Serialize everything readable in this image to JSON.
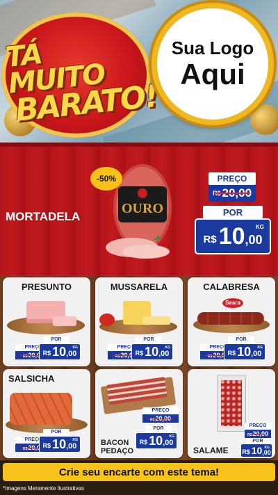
{
  "header": {
    "slogan_line1": "TÁ MUITO",
    "slogan_line2": "BARATO!",
    "logo_line1": "Sua Logo",
    "logo_line2": "Aqui"
  },
  "featured": {
    "name": "MORTADELA",
    "discount": "-50%",
    "brand_label": "OURO",
    "preco_label": "PREÇO",
    "old_currency": "R$",
    "old_price": "20,00",
    "por_label": "POR",
    "currency": "R$",
    "price_int": "10",
    "price_dec": ",00",
    "unit": "KG"
  },
  "cards": [
    {
      "name": "PRESUNTO",
      "preco_label": "PREÇO",
      "old_currency": "R$",
      "old_price": "20,00",
      "por_label": "POR",
      "currency": "R$",
      "price_int": "10",
      "price_dec": ",00",
      "unit": "KG"
    },
    {
      "name": "MUSSARELA",
      "preco_label": "PREÇO",
      "old_currency": "R$",
      "old_price": "20,00",
      "por_label": "POR",
      "currency": "R$",
      "price_int": "10",
      "price_dec": ",00",
      "unit": "KG"
    },
    {
      "name": "CALABRESA",
      "brand": "Seara",
      "preco_label": "PREÇO",
      "old_currency": "R$",
      "old_price": "20,00",
      "por_label": "POR",
      "currency": "R$",
      "price_int": "10",
      "price_dec": ",00",
      "unit": "KG"
    },
    {
      "name": "SALSICHA",
      "preco_label": "PREÇO",
      "old_currency": "R$",
      "old_price": "20,00",
      "por_label": "POR",
      "currency": "R$",
      "price_int": "10",
      "price_dec": ",00",
      "unit": "KG"
    },
    {
      "name_line1": "BACON",
      "name_line2": "PEDAÇO",
      "preco_label": "PREÇO",
      "old_currency": "R$",
      "old_price": "20,00",
      "por_label": "POR",
      "currency": "R$",
      "price_int": "10",
      "price_dec": ",00",
      "unit": "KG"
    },
    {
      "name": "SALAME",
      "preco_label": "PREÇO",
      "old_currency": "R$",
      "old_price": "20,00",
      "por_label": "POR",
      "currency": "R$",
      "price_int": "10",
      "price_dec": ",00",
      "unit": "KG"
    }
  ],
  "footer": {
    "cta": "Crie seu encarte com este tema!",
    "note": "*Imagens Meramente Ilustrativas"
  },
  "colors": {
    "primary_red": "#c01a20",
    "price_blue": "#1a3aa0",
    "accent_yellow": "#f7c31b",
    "slogan_yellow": "#ffd84a"
  }
}
